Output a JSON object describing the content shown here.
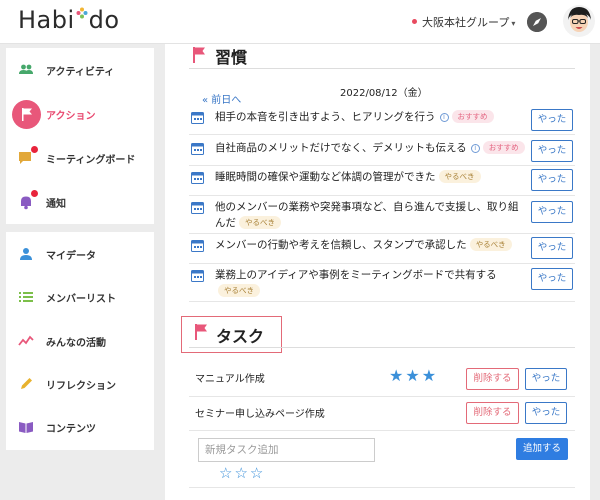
{
  "header": {
    "logo_text_before": "Habi",
    "logo_text_after": "do",
    "group_label": "大阪本社グループ",
    "caret": "▾",
    "icons": [
      "flower-logo-icon",
      "compass-icon",
      "avatar"
    ]
  },
  "sidebar": {
    "group1": [
      {
        "label": "アクティビティ",
        "icon": "people-icon"
      },
      {
        "label": "アクション",
        "icon": "flag-icon",
        "active": true
      },
      {
        "label": "ミーティングボード",
        "icon": "chat-icon",
        "badge": true
      },
      {
        "label": "通知",
        "icon": "bell-icon",
        "badge": true
      }
    ],
    "group2": [
      {
        "label": "マイデータ",
        "icon": "person-icon"
      },
      {
        "label": "メンバーリスト",
        "icon": "list-icon"
      },
      {
        "label": "みんなの活動",
        "icon": "trend-icon"
      },
      {
        "label": "リフレクション",
        "icon": "pencil-icon"
      },
      {
        "label": "コンテンツ",
        "icon": "book-icon"
      }
    ]
  },
  "habits": {
    "title": "習慣",
    "back_link": "« 前日へ",
    "date": "2022/08/12（金）",
    "button_label": "やった",
    "items": [
      {
        "text": "相手の本音を引き出すよう、ヒアリングを行う",
        "info": true,
        "badge": "おすすめ",
        "badge_type": "rec"
      },
      {
        "text": "自社商品のメリットだけでなく、デメリットも伝える",
        "info": true,
        "badge": "おすすめ",
        "badge_type": "rec"
      },
      {
        "text": "睡眠時間の確保や運動など体調の管理ができた",
        "info": false,
        "badge": "やるべき",
        "badge_type": "must"
      },
      {
        "text": "他のメンバーの業務や突発事項など、自ら進んで支援し、取り組んだ",
        "info": false,
        "badge": "やるべき",
        "badge_type": "must"
      },
      {
        "text": "メンバーの行動や考えを信頼し、スタンプで承認した",
        "info": false,
        "badge": "やるべき",
        "badge_type": "must"
      },
      {
        "text": "業務上のアイディアや事例をミーティングボードで共有する",
        "info": false,
        "badge": "やるべき",
        "badge_type": "must"
      }
    ]
  },
  "tasks": {
    "title": "タスク",
    "delete_label": "削除する",
    "done_label": "やった",
    "items": [
      {
        "name": "マニュアル作成",
        "stars": "★★★"
      },
      {
        "name": "セミナー申し込みページ作成",
        "stars": ""
      }
    ],
    "new_task_placeholder": "新規タスク追加",
    "add_label": "追加する",
    "new_task_stars": "☆☆☆"
  },
  "colors": {
    "accent_pink": "#e8577a",
    "link_blue": "#3574c5",
    "button_blue": "#2f7de1",
    "star_blue": "#3b90d9"
  }
}
